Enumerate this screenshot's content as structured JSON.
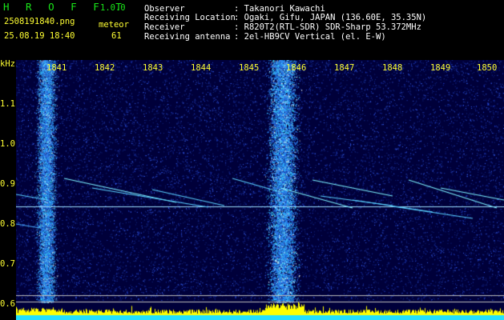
{
  "header": {
    "app_name": "H R O F F T",
    "version": "1.0.0",
    "filename": "2508191840.png",
    "datetime": "25.08.19 18:40",
    "meteor_label": "meteor",
    "meteor_count": "61",
    "fields": [
      {
        "label": "Observer",
        "value": ": Takanori Kawachi"
      },
      {
        "label": "Receiving Location",
        "value": ": Ogaki, Gifu, JAPAN (136.60E, 35.35N)"
      },
      {
        "label": "Receiver",
        "value": ": R820T2(RTL-SDR) SDR-Sharp 53.372MHz"
      },
      {
        "label": "Receiving antenna",
        "value": ": 2el-HB9CV Vertical (el. E-W)"
      }
    ]
  },
  "spectrogram": {
    "y_unit": "kHz",
    "y_ticks": [
      "1.1",
      "1.0",
      "0.9",
      "0.8",
      "0.7",
      "0.6"
    ],
    "x_ticks": [
      "1841",
      "1842",
      "1843",
      "1844",
      "1845",
      "1846",
      "1847",
      "1848",
      "1849",
      "1850"
    ],
    "colors": {
      "background": "#000040",
      "noise": "#1a3ab8",
      "signal": "#ffffff",
      "histogram": "#ffff00",
      "baseline": "#22e0ff"
    }
  }
}
